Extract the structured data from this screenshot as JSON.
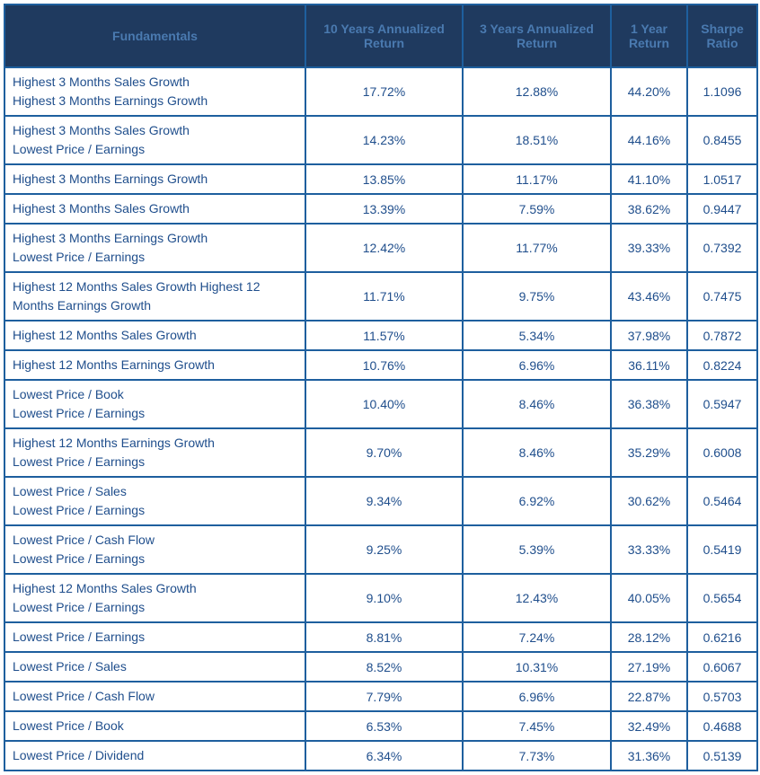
{
  "headers": {
    "fundamentals": "Fundamentals",
    "ten_year": "10 Years Annualized Return",
    "three_year": "3 Years Annualized Return",
    "one_year": "1 Year Return",
    "sharpe": "Sharpe Ratio"
  },
  "chart_data": {
    "type": "table",
    "columns": [
      "Fundamentals",
      "10 Years Annualized Return",
      "3 Years Annualized Return",
      "1 Year Return",
      "Sharpe Ratio"
    ],
    "rows": [
      {
        "label": "Highest 3 Months Sales Growth\nHighest 3 Months Earnings Growth",
        "ten_year": "17.72%",
        "three_year": "12.88%",
        "one_year": "44.20%",
        "sharpe": "1.1096"
      },
      {
        "label": "Highest 3 Months Sales Growth\nLowest Price / Earnings",
        "ten_year": "14.23%",
        "three_year": "18.51%",
        "one_year": "44.16%",
        "sharpe": "0.8455"
      },
      {
        "label": "Highest 3 Months Earnings Growth",
        "ten_year": "13.85%",
        "three_year": "11.17%",
        "one_year": "41.10%",
        "sharpe": "1.0517"
      },
      {
        "label": "Highest 3 Months Sales Growth",
        "ten_year": "13.39%",
        "three_year": "7.59%",
        "one_year": "38.62%",
        "sharpe": "0.9447"
      },
      {
        "label": "Highest 3 Months Earnings Growth\nLowest Price / Earnings",
        "ten_year": "12.42%",
        "three_year": "11.77%",
        "one_year": "39.33%",
        "sharpe": "0.7392"
      },
      {
        "label": "Highest 12 Months Sales Growth Highest 12 Months Earnings Growth",
        "ten_year": "11.71%",
        "three_year": "9.75%",
        "one_year": "43.46%",
        "sharpe": "0.7475"
      },
      {
        "label": "Highest 12 Months Sales Growth",
        "ten_year": "11.57%",
        "three_year": "5.34%",
        "one_year": "37.98%",
        "sharpe": "0.7872"
      },
      {
        "label": "Highest 12 Months Earnings Growth",
        "ten_year": "10.76%",
        "three_year": "6.96%",
        "one_year": "36.11%",
        "sharpe": "0.8224"
      },
      {
        "label": "Lowest Price / Book\nLowest Price / Earnings",
        "ten_year": "10.40%",
        "three_year": "8.46%",
        "one_year": "36.38%",
        "sharpe": "0.5947"
      },
      {
        "label": "Highest 12 Months Earnings Growth\nLowest Price / Earnings",
        "ten_year": "9.70%",
        "three_year": "8.46%",
        "one_year": "35.29%",
        "sharpe": "0.6008"
      },
      {
        "label": "Lowest Price / Sales\nLowest Price / Earnings",
        "ten_year": "9.34%",
        "three_year": "6.92%",
        "one_year": "30.62%",
        "sharpe": "0.5464"
      },
      {
        "label": "Lowest Price / Cash Flow\nLowest Price / Earnings",
        "ten_year": "9.25%",
        "three_year": "5.39%",
        "one_year": "33.33%",
        "sharpe": "0.5419"
      },
      {
        "label": "Highest 12 Months Sales Growth\nLowest Price / Earnings",
        "ten_year": "9.10%",
        "three_year": "12.43%",
        "one_year": "40.05%",
        "sharpe": "0.5654"
      },
      {
        "label": "Lowest Price / Earnings",
        "ten_year": "8.81%",
        "three_year": "7.24%",
        "one_year": "28.12%",
        "sharpe": "0.6216"
      },
      {
        "label": "Lowest Price / Sales",
        "ten_year": "8.52%",
        "three_year": "10.31%",
        "one_year": "27.19%",
        "sharpe": "0.6067"
      },
      {
        "label": "Lowest Price / Cash Flow",
        "ten_year": "7.79%",
        "three_year": "6.96%",
        "one_year": "22.87%",
        "sharpe": "0.5703"
      },
      {
        "label": "Lowest Price / Book",
        "ten_year": "6.53%",
        "three_year": "7.45%",
        "one_year": "32.49%",
        "sharpe": "0.4688"
      },
      {
        "label": "Lowest Price / Dividend",
        "ten_year": "6.34%",
        "three_year": "7.73%",
        "one_year": "31.36%",
        "sharpe": "0.5139"
      }
    ]
  }
}
